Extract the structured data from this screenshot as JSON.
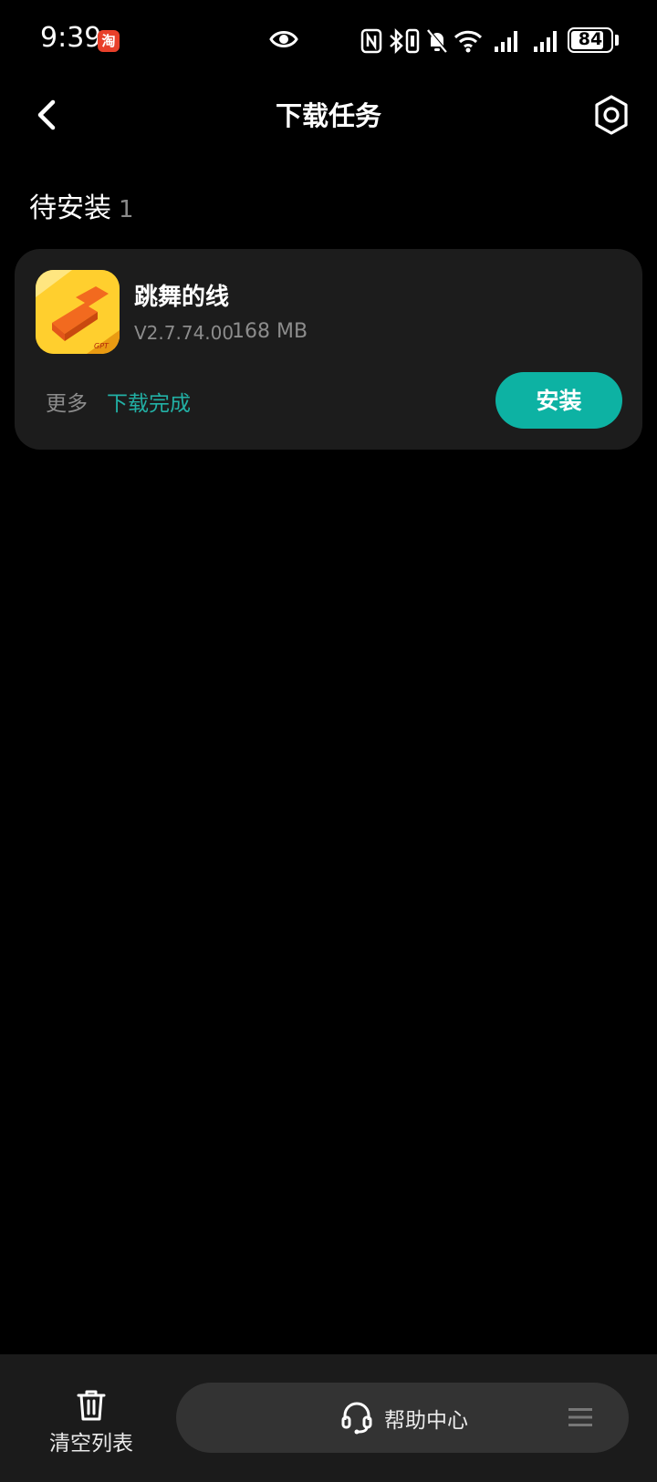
{
  "status_bar": {
    "time": "9:39",
    "notification_app_glyph": "淘",
    "battery_level": "84",
    "battery_fraction": 0.84,
    "icons": [
      "taobao-icon",
      "eye-icon",
      "nfc-icon",
      "bluetooth-icon",
      "vibrate-icon",
      "mute-bell-icon",
      "wifi-icon",
      "signal-icon",
      "signal-icon",
      "battery-icon"
    ]
  },
  "header": {
    "title": "下载任务",
    "back_icon": "chevron-left-icon",
    "settings_icon": "settings-hexagon-icon"
  },
  "section": {
    "title": "待安装",
    "count": "1"
  },
  "download_item": {
    "app_name": "跳舞的线",
    "version": "V2.7.74.00",
    "size": "168 MB",
    "more_label": "更多",
    "status": "下载完成",
    "install_label": "安装"
  },
  "bottom_bar": {
    "clear_label": "清空列表",
    "clear_icon": "trash-icon",
    "help_label": "帮助中心",
    "help_icon": "headset-icon",
    "menu_icon": "menu-icon"
  },
  "colors": {
    "background": "#000000",
    "card": "#1c1c1c",
    "accent": "#0db2a3",
    "status_text": "#22b0a5",
    "secondary_text": "#8c8c8c"
  }
}
